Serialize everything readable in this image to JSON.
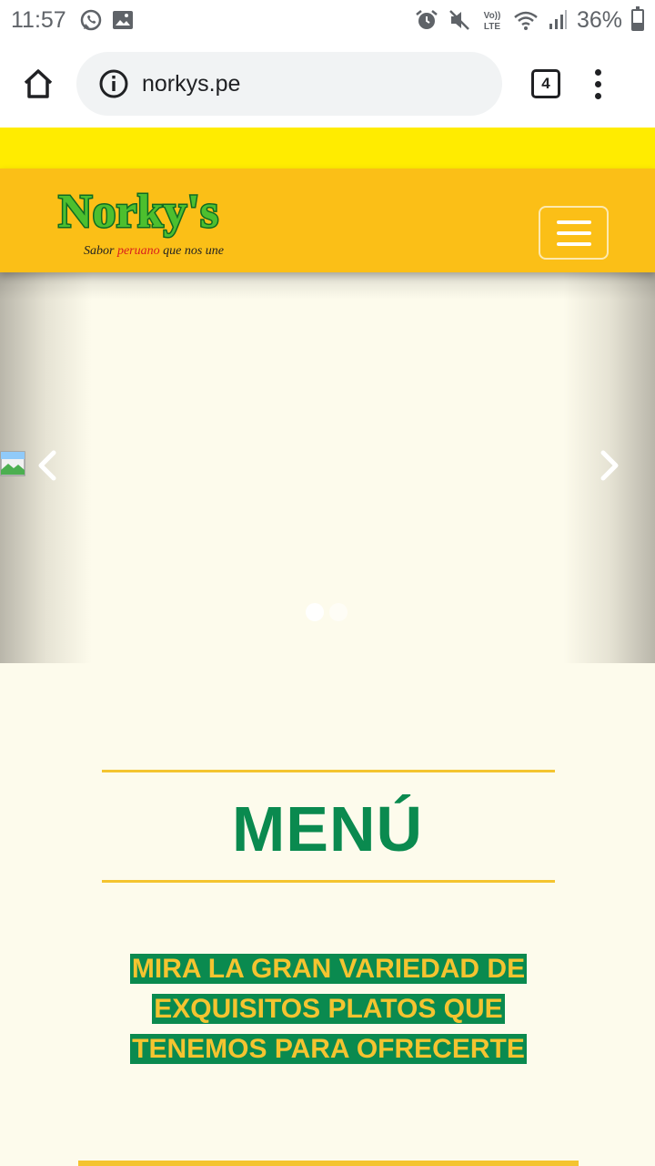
{
  "status_bar": {
    "time": "11:57",
    "left_icons": [
      "whatsapp-icon",
      "image-icon"
    ],
    "right_icons": [
      "alarm-icon",
      "mute-icon",
      "volte-icon",
      "wifi-icon",
      "signal-icon"
    ],
    "volte_label": "Vo)) LTE",
    "battery": "36%",
    "battery_level": 0.36
  },
  "browser": {
    "url": "norkys.pe",
    "tab_count": "4"
  },
  "header": {
    "logo_text": "Norky's",
    "tagline_part1": "Sabor",
    "tagline_highlight": "peruano",
    "tagline_part2": "que nos une"
  },
  "carousel": {
    "slide_count": 2,
    "active_slide": 1
  },
  "menu": {
    "title": "MENÚ",
    "subtitle": "MIRA LA GRAN VARIEDAD DE EXQUISITOS PLATOS QUE TENEMOS PARA OFRECERTE"
  },
  "colors": {
    "brand_green": "#0a8a4f",
    "brand_yellow": "#f4c430",
    "header_orange": "#fbbf17",
    "top_strip_yellow": "#ffec00",
    "page_cream": "#fdfbec"
  }
}
